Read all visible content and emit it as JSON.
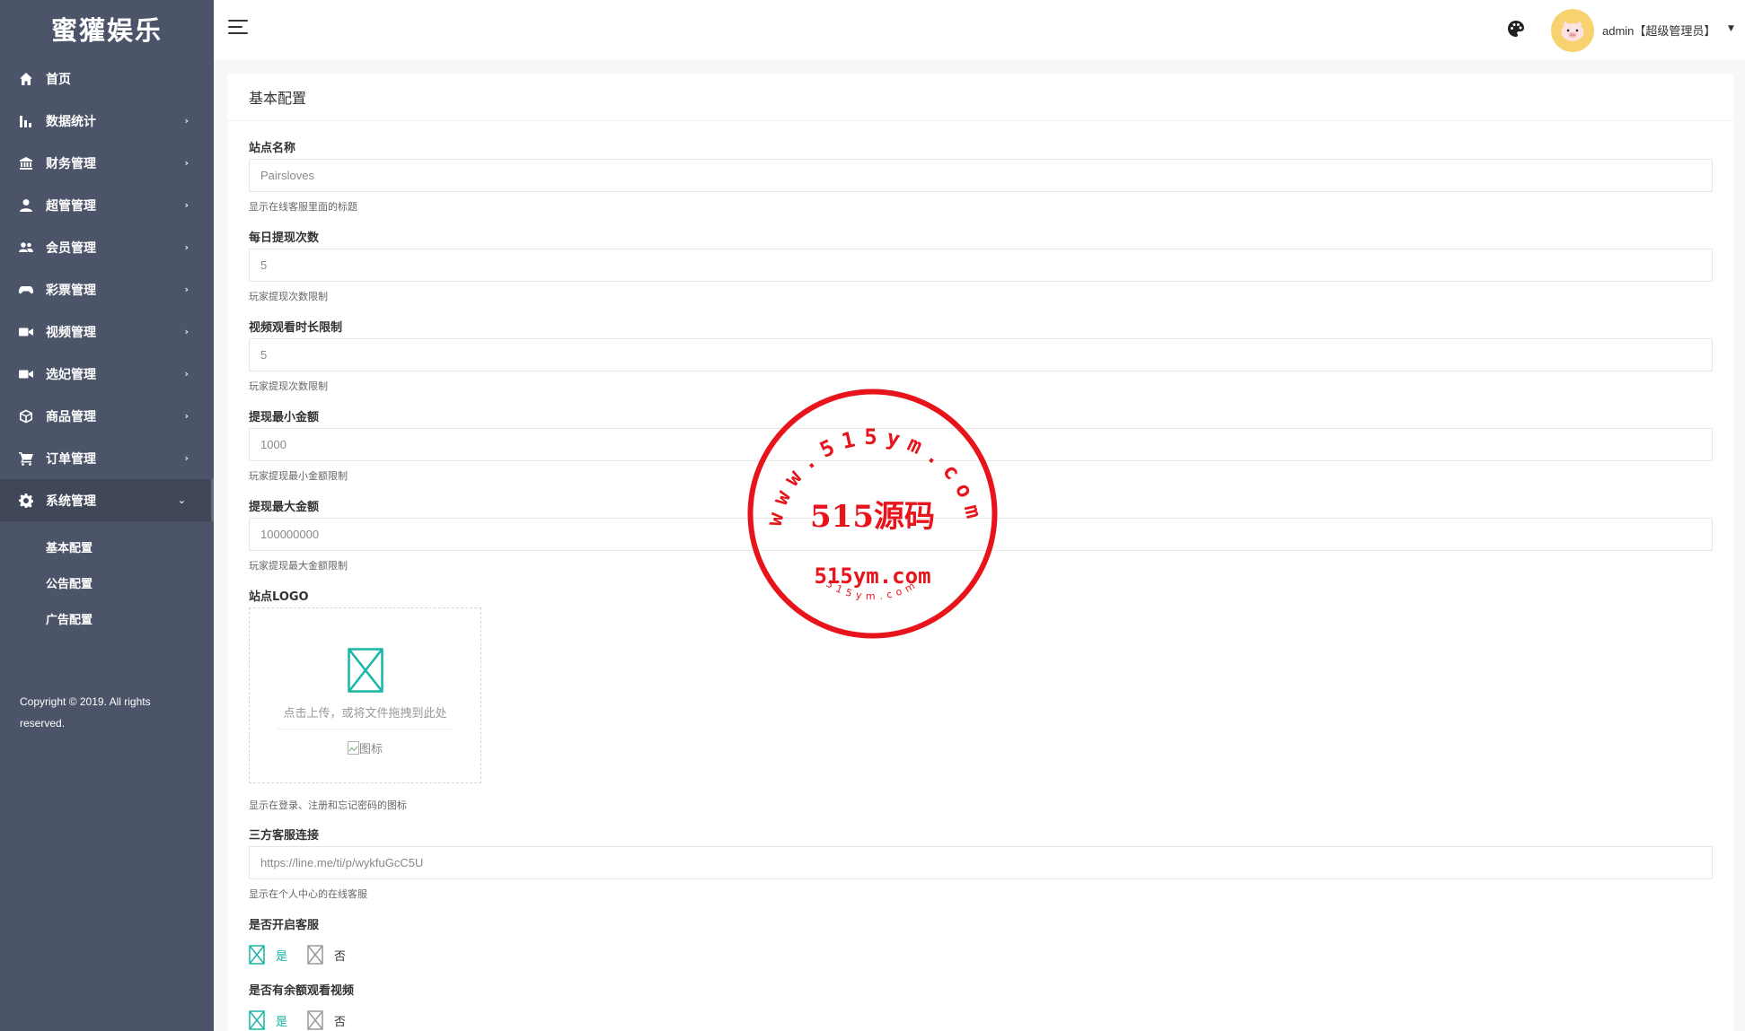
{
  "brand": "蜜獾娱乐",
  "sidebar": {
    "items": [
      {
        "label": "首页",
        "icon": "home-icon"
      },
      {
        "label": "数据统计",
        "icon": "bar-chart-icon"
      },
      {
        "label": "财务管理",
        "icon": "bank-icon"
      },
      {
        "label": "超管管理",
        "icon": "user-icon"
      },
      {
        "label": "会员管理",
        "icon": "users-icon"
      },
      {
        "label": "彩票管理",
        "icon": "gamepad-icon"
      },
      {
        "label": "视频管理",
        "icon": "video-icon"
      },
      {
        "label": "选妃管理",
        "icon": "video-icon"
      },
      {
        "label": "商品管理",
        "icon": "box-icon"
      },
      {
        "label": "订单管理",
        "icon": "cart-icon"
      },
      {
        "label": "系统管理",
        "icon": "gear-icon"
      }
    ],
    "sub_items": [
      "基本配置",
      "公告配置",
      "广告配置"
    ],
    "copyright": "Copyright © 2019. All rights reserved."
  },
  "header": {
    "user": "admin【超级管理员】"
  },
  "card": {
    "title": "基本配置",
    "fields": [
      {
        "label": "站点名称",
        "value": "Pairsloves",
        "help": "显示在线客服里面的标题"
      },
      {
        "label": "每日提现次数",
        "value": "5",
        "help": "玩家提现次数限制"
      },
      {
        "label": "视频观看时长限制",
        "value": "5",
        "help": "玩家提现次数限制"
      },
      {
        "label": "提现最小金额",
        "value": "1000",
        "help": "玩家提现最小金额限制"
      },
      {
        "label": "提现最大金额",
        "value": "100000000",
        "help": "玩家提现最大金额限制"
      }
    ],
    "logo": {
      "label": "站点LOGO",
      "upload_text": "点击上传，或将文件拖拽到此处",
      "img_alt": "图标",
      "help": "显示在登录、注册和忘记密码的图标"
    },
    "service_link": {
      "label": "三方客服连接",
      "value": "https://line.me/ti/p/wykfuGcC5U",
      "help": "显示在个人中心的在线客服"
    },
    "service_enable": {
      "label": "是否开启客服",
      "yes": "是",
      "no": "否"
    },
    "balance_video": {
      "label": "是否有余额观看视频",
      "yes": "是",
      "no": "否"
    }
  },
  "watermark": {
    "ring": "www.515ym.com",
    "center": "515源码",
    "domain": "515ym.com",
    "small": "515ym.com"
  },
  "colors": {
    "sidebar": "#4b5468",
    "accent": "#18b6a4",
    "stamp": "#e8141b"
  }
}
